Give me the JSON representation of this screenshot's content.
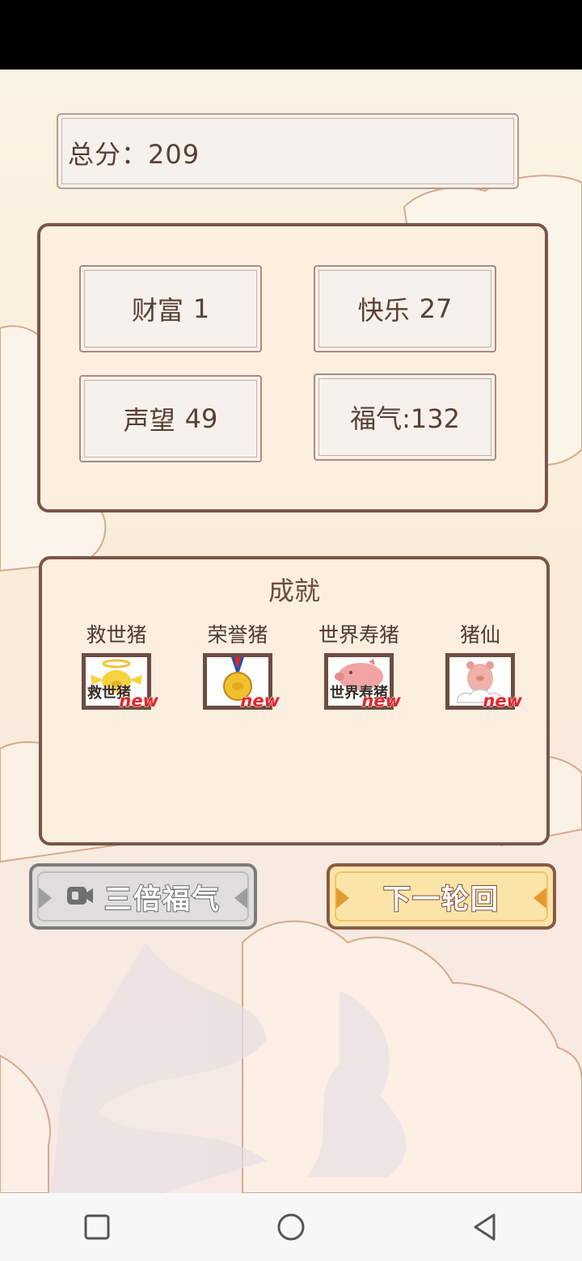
{
  "score": {
    "text": "总分：209"
  },
  "stats": [
    {
      "label": "财富",
      "value": "1"
    },
    {
      "label": "快乐",
      "value": "27"
    },
    {
      "label": "声望",
      "value": "49"
    },
    {
      "label": "福气:132",
      "value": ""
    }
  ],
  "achievements": {
    "title": "成就",
    "items": [
      {
        "name": "救世猪",
        "caption": "救世猪",
        "tag": "new",
        "icon": "angel-pig-icon"
      },
      {
        "name": "荣誉猪",
        "caption": "",
        "tag": "new",
        "icon": "gold-medal-icon"
      },
      {
        "name": "世界寿猪",
        "caption": "世界寿猪",
        "tag": "new",
        "icon": "pink-pig-icon"
      },
      {
        "name": "猪仙",
        "caption": "",
        "tag": "new",
        "icon": "cloud-pig-icon"
      }
    ]
  },
  "buttons": {
    "triple_label": "三倍福气",
    "next_label": "下一轮回"
  },
  "colors": {
    "panel_border": "#7a5548",
    "panel_bg": "#fdefe0",
    "next_button": "#fbe4a8",
    "new_tag": "#e8232a"
  }
}
